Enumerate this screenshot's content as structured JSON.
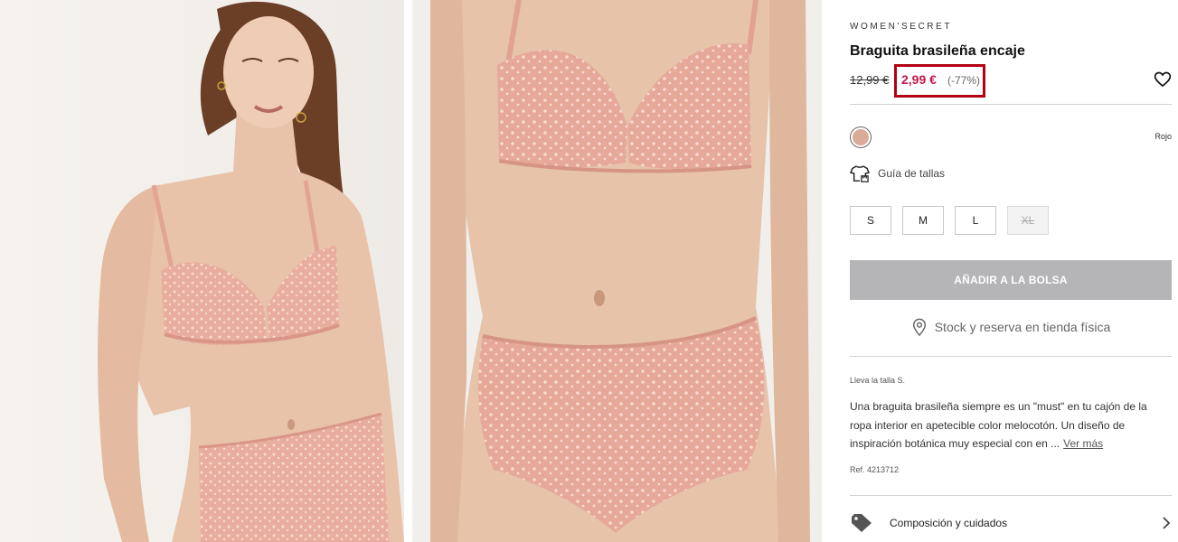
{
  "images": [
    {
      "name": "model-full-photo",
      "alt": ""
    },
    {
      "name": "model-closeup-photo",
      "alt": ""
    }
  ],
  "product": {
    "brand": "WOMEN'SECRET",
    "title": "Braguita brasileña encaje",
    "old_price": "12,99 €",
    "new_price": "2,99 €",
    "discount": "(-77%)",
    "color": {
      "name": "Rojo",
      "swatch_hex": "#d9ab98"
    },
    "size_guide": "Guía de tallas",
    "sizes": [
      {
        "label": "S",
        "available": true
      },
      {
        "label": "M",
        "available": true
      },
      {
        "label": "L",
        "available": true
      },
      {
        "label": "XL",
        "available": false
      }
    ],
    "add_to_bag": "AÑADIR A LA BOLSA",
    "store_stock": "Stock y reserva en tienda física",
    "wears_size": "Lleva la talla S.",
    "description": "Una braguita brasileña siempre es un \"must\" en tu cajón de la ropa interior en apetecible color melocotón. Un diseño de inspiración botánica muy especial con en ...",
    "see_more": "Ver más",
    "reference": "Ref. 4213712",
    "composition": "Composición y cuidados"
  },
  "colors": {
    "sale_price": "#c1184b",
    "highlight_box": "#b30012",
    "button_disabled": "#b5b5b8",
    "lingerie": "#e3a89a"
  },
  "icons": [
    "heart-icon",
    "tshirt-icon",
    "location-pin-icon",
    "tag-icon",
    "chevron-right-icon"
  ]
}
